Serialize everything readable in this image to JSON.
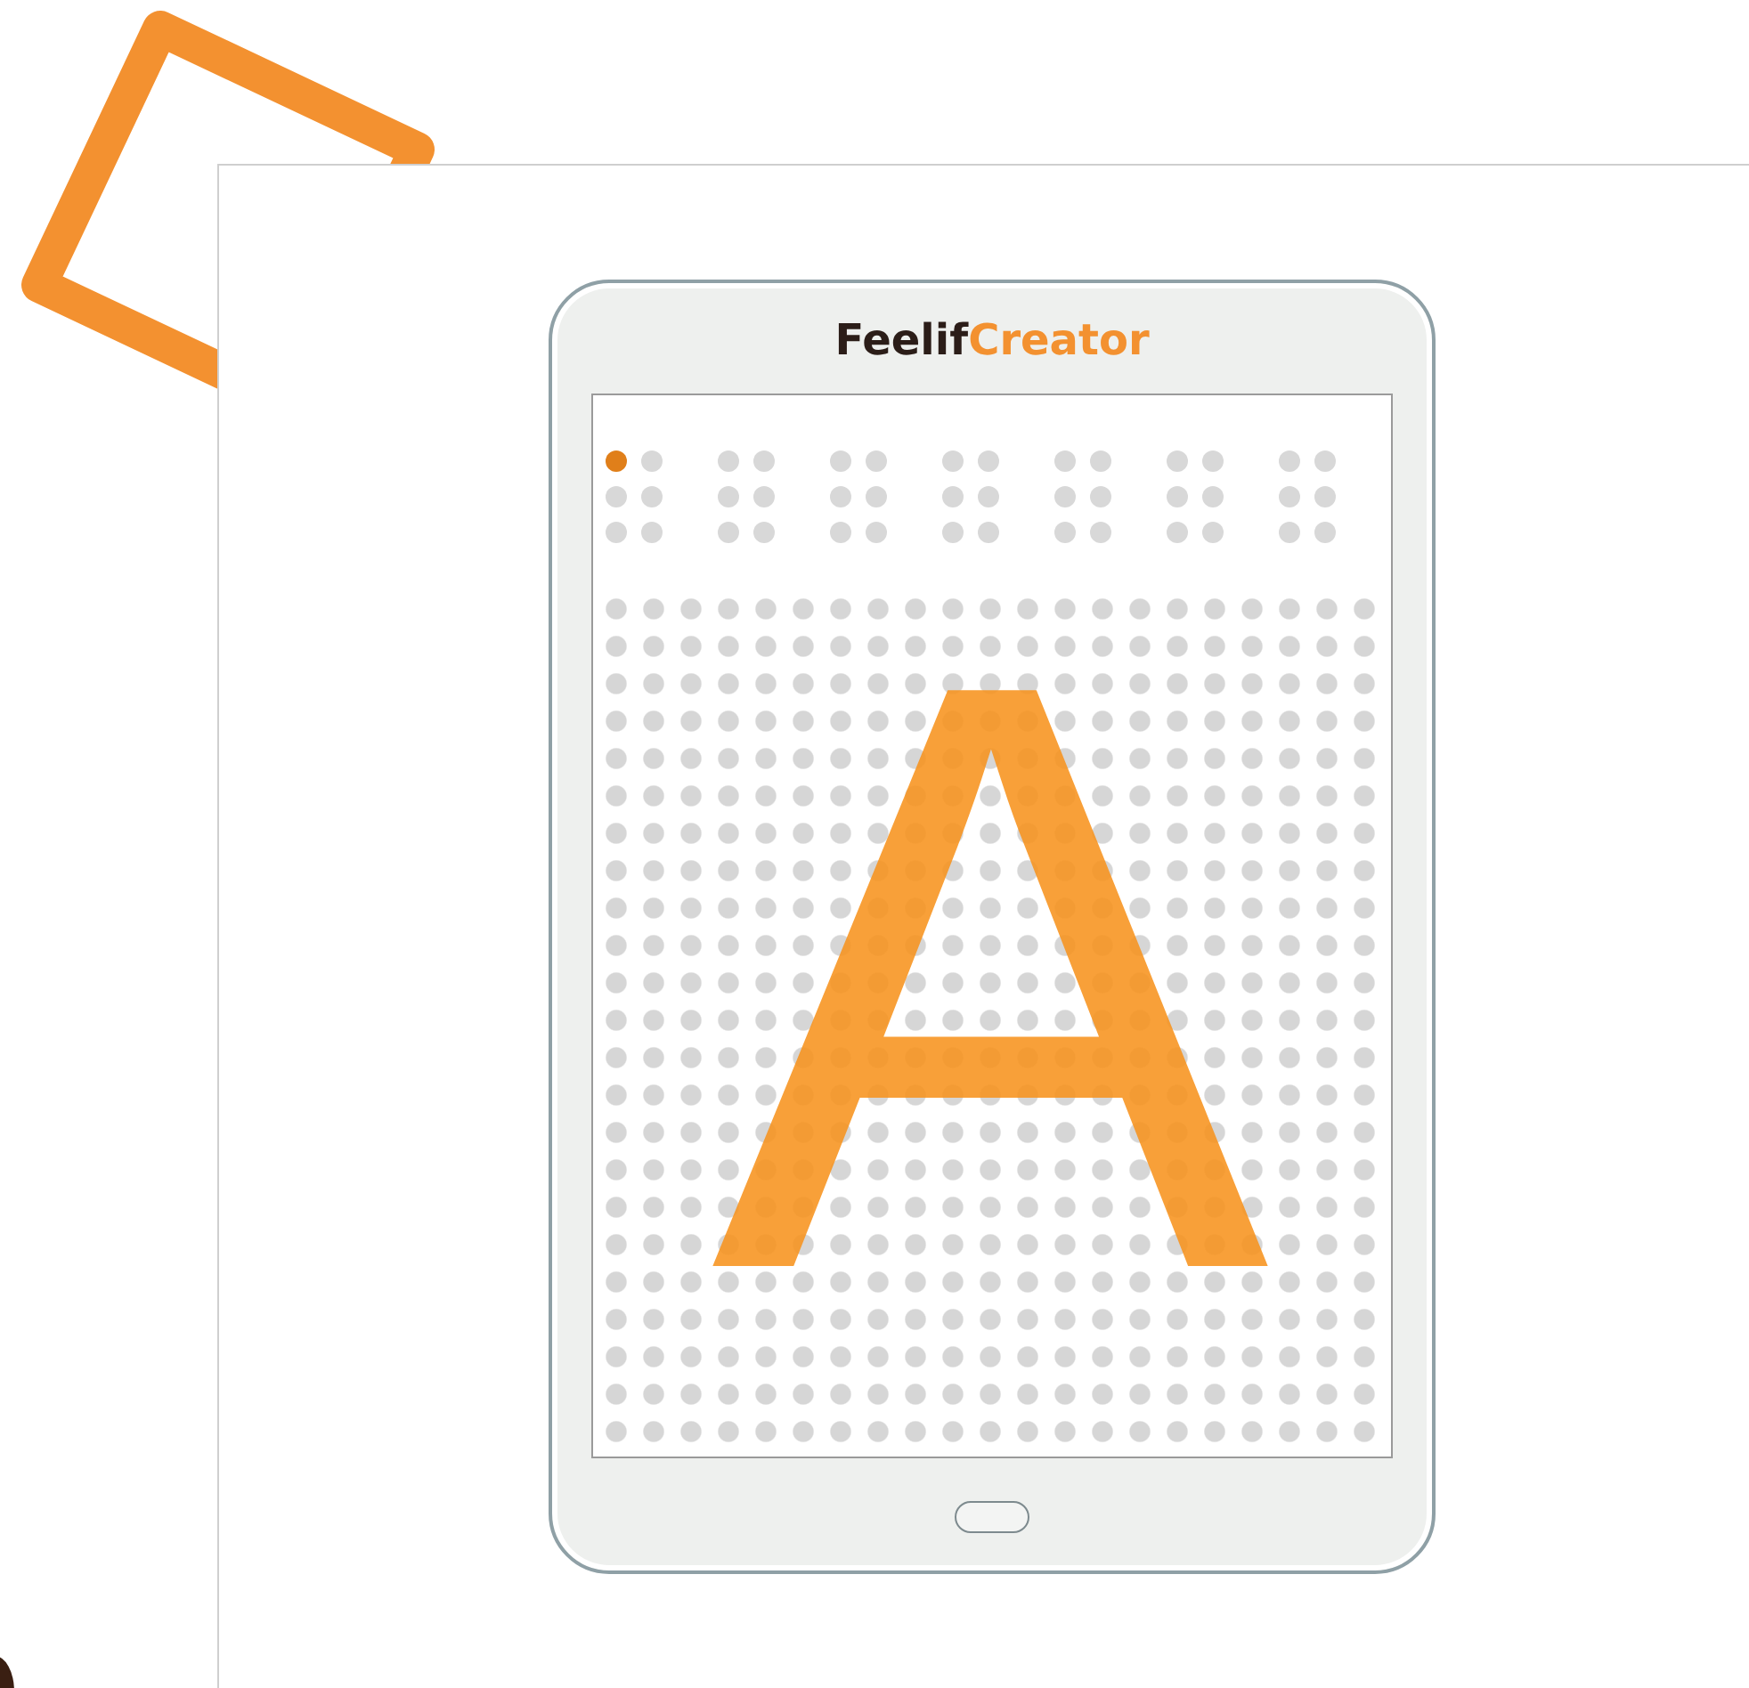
{
  "tablet": {
    "logo": {
      "brand": "Feelif",
      "product": "Creator"
    },
    "braille_row": [
      {
        "dots": [
          {
            "active": true
          },
          {
            "active": false
          },
          {
            "active": false
          },
          {
            "active": false
          },
          {
            "active": false
          },
          {
            "active": false
          }
        ]
      },
      {
        "dots": [
          {
            "active": false
          },
          {
            "active": false
          },
          {
            "active": false
          },
          {
            "active": false
          },
          {
            "active": false
          },
          {
            "active": false
          }
        ]
      },
      {
        "dots": [
          {
            "active": false
          },
          {
            "active": false
          },
          {
            "active": false
          },
          {
            "active": false
          },
          {
            "active": false
          },
          {
            "active": false
          }
        ]
      },
      {
        "dots": [
          {
            "active": false
          },
          {
            "active": false
          },
          {
            "active": false
          },
          {
            "active": false
          },
          {
            "active": false
          },
          {
            "active": false
          }
        ]
      },
      {
        "dots": [
          {
            "active": false
          },
          {
            "active": false
          },
          {
            "active": false
          },
          {
            "active": false
          },
          {
            "active": false
          },
          {
            "active": false
          }
        ]
      },
      {
        "dots": [
          {
            "active": false
          },
          {
            "active": false
          },
          {
            "active": false
          },
          {
            "active": false
          },
          {
            "active": false
          },
          {
            "active": false
          }
        ]
      },
      {
        "dots": [
          {
            "active": false
          },
          {
            "active": false
          },
          {
            "active": false
          },
          {
            "active": false
          },
          {
            "active": false
          },
          {
            "active": false
          }
        ]
      }
    ],
    "letter": "A"
  }
}
